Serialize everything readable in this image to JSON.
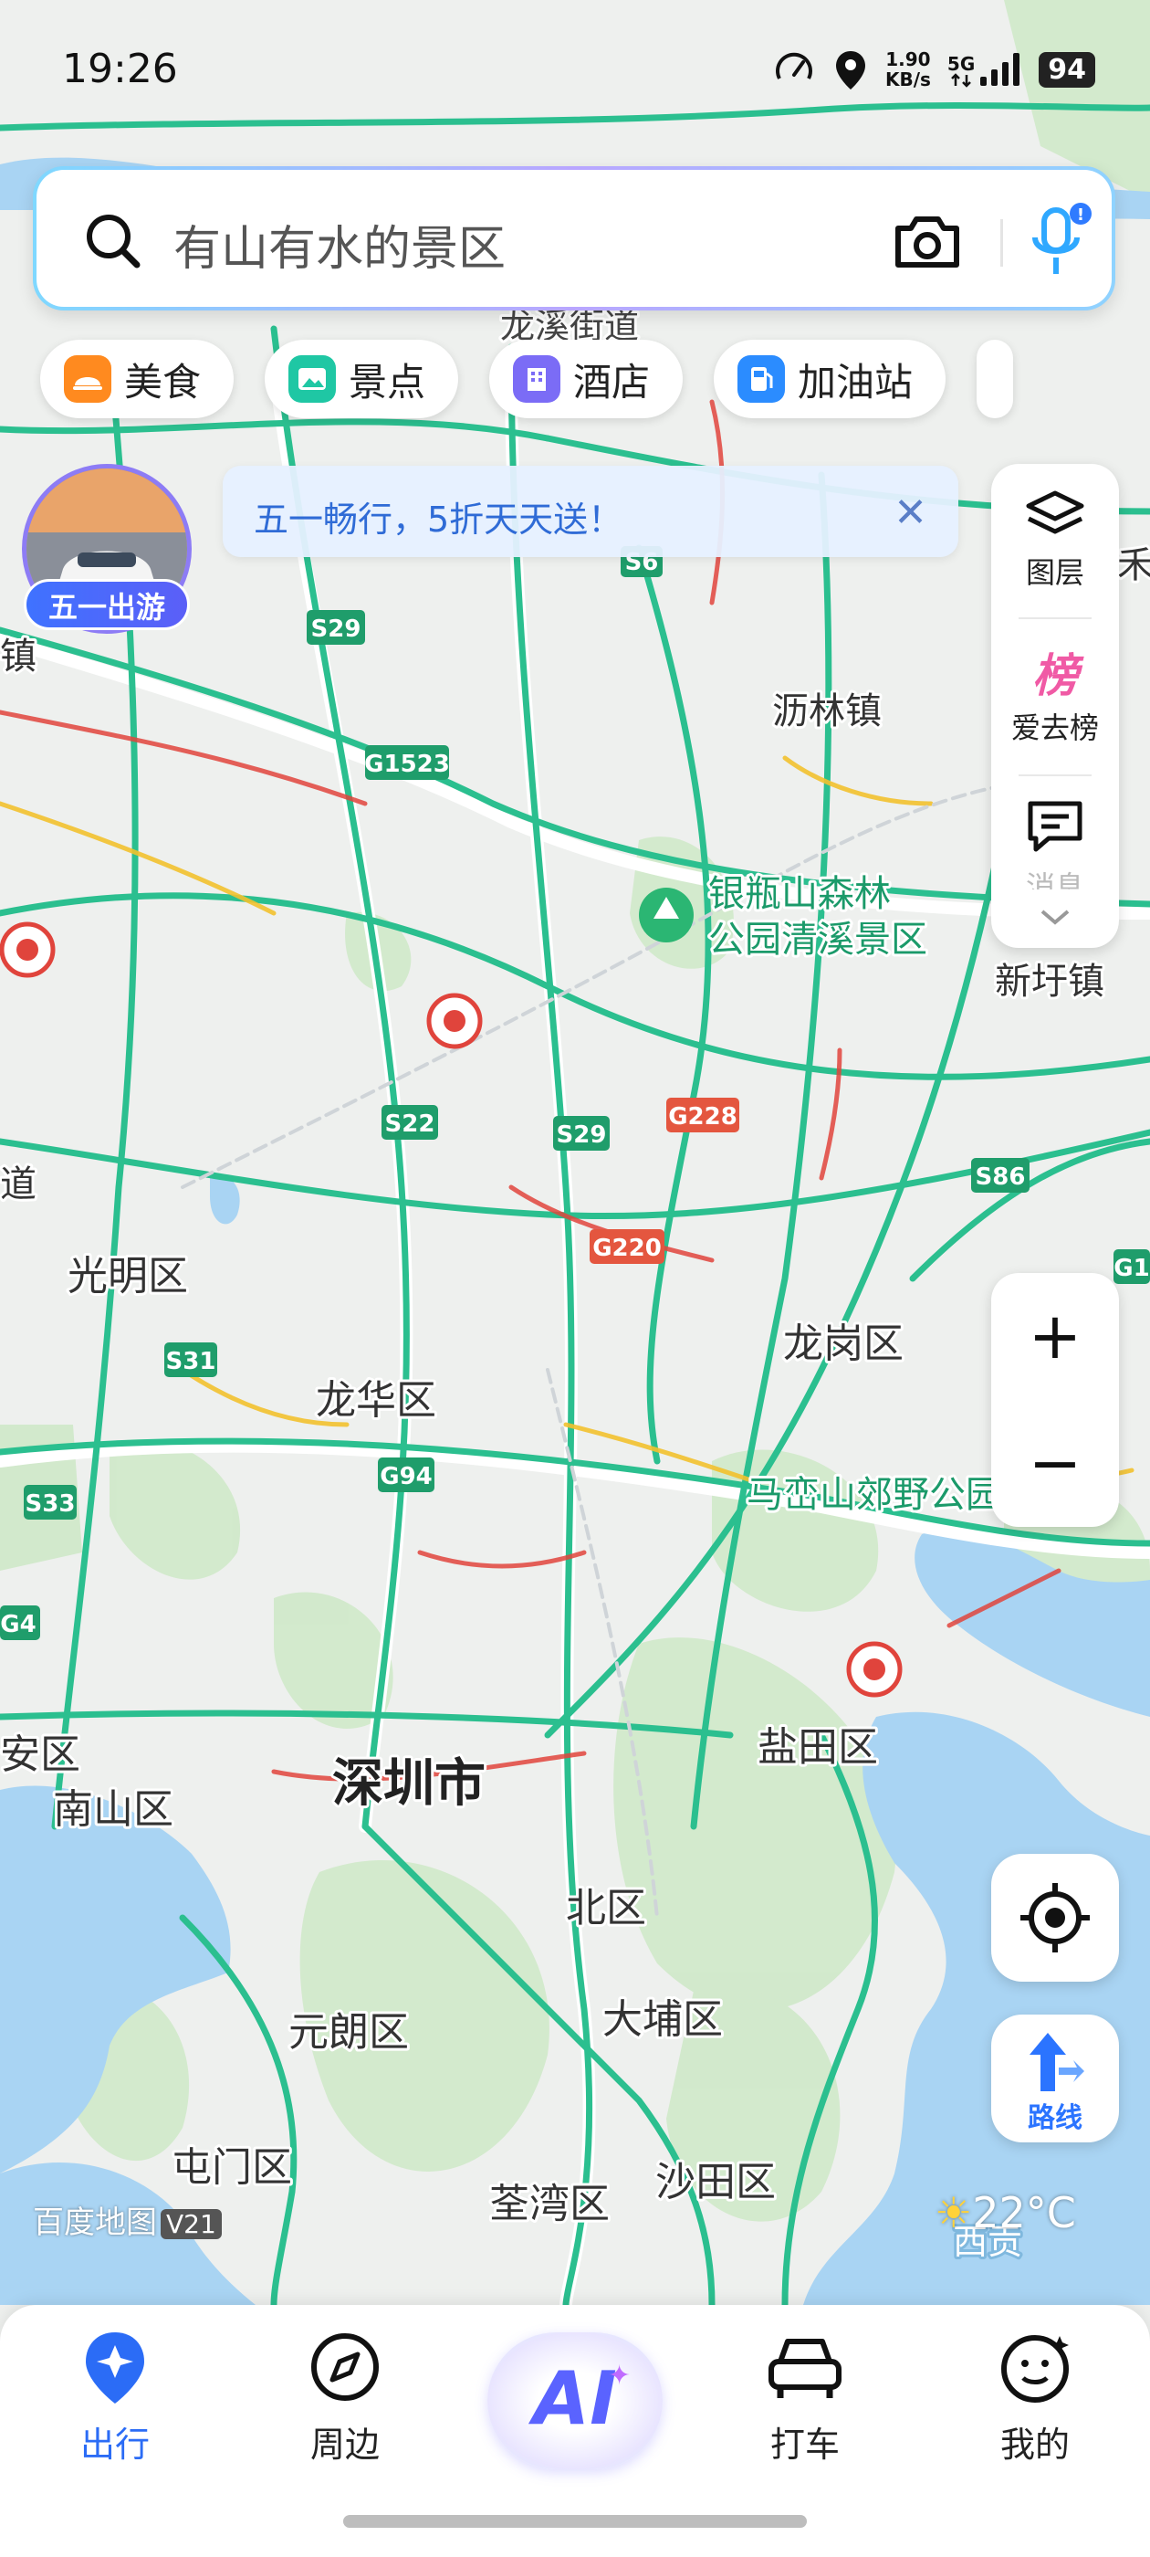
{
  "status_bar": {
    "time": "19:26",
    "net_speed_value": "1.90",
    "net_speed_unit": "KB/s",
    "network": "5G",
    "battery": "94"
  },
  "search": {
    "placeholder": "有山有水的景区",
    "icons": [
      "search-icon",
      "camera-icon",
      "mic-icon"
    ]
  },
  "categories": [
    {
      "label": "美食",
      "icon": "food-icon",
      "color": "#ff8a1f"
    },
    {
      "label": "景点",
      "icon": "scenic-icon",
      "color": "#1fc7a4"
    },
    {
      "label": "酒店",
      "icon": "hotel-icon",
      "color": "#7b6cf6"
    },
    {
      "label": "加油站",
      "icon": "gas-station-icon",
      "color": "#2b8cff"
    }
  ],
  "promo": {
    "avatar_label": "五一出游",
    "banner_text": "五一畅行，5折天天送！"
  },
  "right_panel": {
    "layers_label": "图层",
    "rank_icon_text": "榜",
    "rank_label": "爱去榜",
    "messages_label": "消息"
  },
  "map_labels": {
    "road_over_search": "龙溪街道",
    "s6": "S6",
    "s29_top": "S29",
    "g1523": "G1523",
    "town_left": "镇",
    "lilin": "沥林镇",
    "yinpingshan": "银瓶山森林\n公园清溪景区",
    "xinxu": "新圩镇",
    "s22": "S22",
    "s29_mid": "S29",
    "g228": "G228",
    "s86": "S86",
    "dao_left": "道",
    "g220": "G220",
    "guangming": "光明区",
    "longgang": "龙岗区",
    "g1_right": "G1",
    "s31": "S31",
    "longhua": "龙华区",
    "s33": "S33",
    "g94": "G94",
    "maluanshan": "马峦山郊野公园",
    "g4": "G4",
    "shenzhen": "深圳市",
    "yantian": "盐田区",
    "anqu": "安区",
    "nanshan": "南山区",
    "beiqu": "北区",
    "yuanlang": "元朗区",
    "dapu": "大埔区",
    "tunmen": "屯门区",
    "quanwan": "荃湾区",
    "shatian": "沙田区",
    "xigong": "西贡",
    "right_edge": "禾"
  },
  "map_footer": {
    "brand": "百度地图",
    "version": "V21",
    "weather": "22°C"
  },
  "tabs": [
    {
      "label": "出行",
      "icon": "travel-icon",
      "active": true
    },
    {
      "label": "周边",
      "icon": "compass-icon",
      "active": false
    },
    {
      "label": "AI",
      "icon": "ai-icon",
      "active": false
    },
    {
      "label": "打车",
      "icon": "car-icon",
      "active": false
    },
    {
      "label": "我的",
      "icon": "profile-icon",
      "active": false
    }
  ],
  "controls": {
    "zoom_in": "+",
    "zoom_out": "−",
    "route_label": "路线"
  },
  "colors": {
    "accent": "#2b6cf6",
    "water": "#a9d4f3",
    "green_area": "#cfe9c9",
    "road_green": "#2bbf8f",
    "road_red": "#e0443c",
    "road_yellow": "#f2c12e"
  }
}
